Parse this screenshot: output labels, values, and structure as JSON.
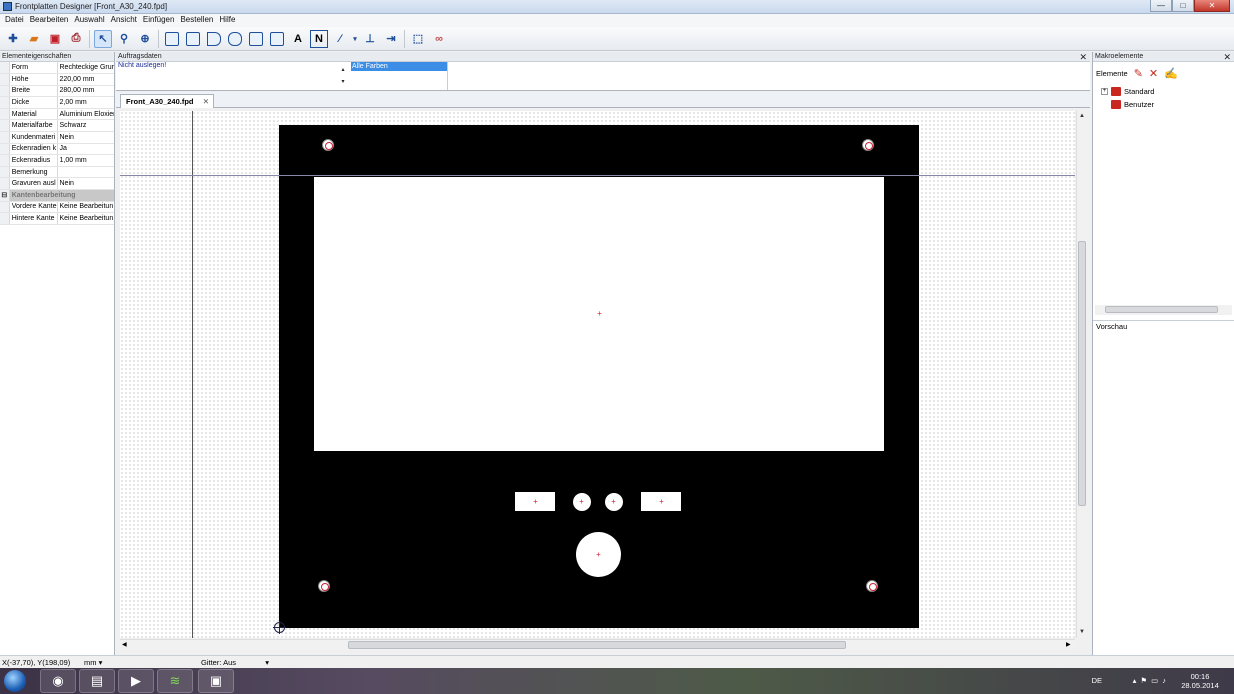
{
  "window": {
    "title": "Frontplatten Designer [Front_A30_240.fpd]",
    "controls": {
      "minimize": "—",
      "maximize": "□",
      "close": "✕"
    }
  },
  "menu": [
    "Datei",
    "Bearbeiten",
    "Auswahl",
    "Ansicht",
    "Einfügen",
    "Bestellen",
    "Hilfe"
  ],
  "toolbar_icons": [
    "new-file-icon",
    "open-folder-icon",
    "save-icon",
    "print-icon",
    "select-arrow-icon",
    "zoom-icon",
    "crosshair-icon",
    "element-1-icon",
    "element-2-icon",
    "element-3-icon",
    "element-4-icon",
    "element-5-icon",
    "element-6-icon",
    "text-icon",
    "engraving-icon",
    "line-icon",
    "measure-icon",
    "dimension-icon",
    "marquee-icon",
    "link-icon"
  ],
  "toolbar_text_label": "A",
  "toolbar_engrave_label": "N",
  "left_panel": {
    "title": "Elementeigenschaften",
    "rows": [
      {
        "key": "Form",
        "value": "Rechteckige Grur"
      },
      {
        "key": "Höhe",
        "value": "220,00 mm"
      },
      {
        "key": "Breite",
        "value": "280,00 mm"
      },
      {
        "key": "Dicke",
        "value": "2,00 mm"
      },
      {
        "key": "Material",
        "value": "Aluminium Eloxier"
      },
      {
        "key": "Materialfarbe",
        "value": "Schwarz"
      },
      {
        "key": "Kundenmateri",
        "value": "Nein"
      },
      {
        "key": "Eckenradien k",
        "value": "Ja"
      },
      {
        "key": "Eckenradius",
        "value": "1,00 mm"
      },
      {
        "key": "Bemerkung",
        "value": ""
      },
      {
        "key": "Gravuren ausl",
        "value": "Nein"
      }
    ],
    "category": "Kantenbearbeitung",
    "category_rows": [
      {
        "key": "Vordere Kante",
        "value": "Keine Bearbeitun"
      },
      {
        "key": "Hintere Kante",
        "value": "Keine Bearbeitun"
      }
    ]
  },
  "auftragsdaten": {
    "title": "Auftragsdaten",
    "option": "Nicht auslegen!",
    "color_filter": "Alle Farben"
  },
  "document_tab": "Front_A30_240.fpd",
  "right_panel": {
    "title": "Makroelemente",
    "elements_label": "Elemente",
    "tree": [
      "Standard",
      "Benutzer"
    ],
    "preview_label": "Vorschau"
  },
  "status": {
    "coordinates": "X(-37,70), Y(198,09)",
    "unit": "mm",
    "grid": "Gitter: Aus"
  },
  "taskbar": {
    "lang": "DE",
    "time": "00:16",
    "date": "28.05.2014"
  },
  "colors": {
    "panel": "#000000",
    "cutout": "#ffffff",
    "center_mark": "#cc2233",
    "selection": "#3b8de5"
  }
}
